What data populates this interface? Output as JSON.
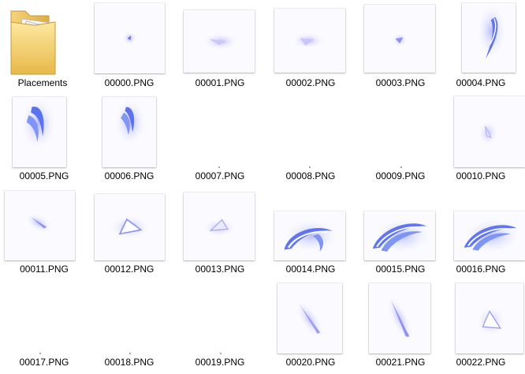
{
  "folder": {
    "label": "Placements",
    "icon": "folder-icon"
  },
  "files": [
    {
      "name": "00000.PNG",
      "preview": "small-spark"
    },
    {
      "name": "00001.PNG",
      "preview": "small-slash"
    },
    {
      "name": "00002.PNG",
      "preview": "small-slash"
    },
    {
      "name": "00003.PNG",
      "preview": "small-spark"
    },
    {
      "name": "00004.PNG",
      "preview": "curved-streak"
    },
    {
      "name": "00005.PNG",
      "preview": "curved-streak"
    },
    {
      "name": "00006.PNG",
      "preview": "curved-streak"
    },
    {
      "name": "00007.PNG",
      "preview": "blank"
    },
    {
      "name": "00008.PNG",
      "preview": "blank"
    },
    {
      "name": "00009.PNG",
      "preview": "blank"
    },
    {
      "name": "00010.PNG",
      "preview": "small-spark"
    },
    {
      "name": "00011.PNG",
      "preview": "diagonal-slash"
    },
    {
      "name": "00012.PNG",
      "preview": "triangle-slash"
    },
    {
      "name": "00013.PNG",
      "preview": "triangle-slash"
    },
    {
      "name": "00014.PNG",
      "preview": "arc-slash"
    },
    {
      "name": "00015.PNG",
      "preview": "arc-slash"
    },
    {
      "name": "00016.PNG",
      "preview": "arc-slash"
    },
    {
      "name": "00017.PNG",
      "preview": "blank"
    },
    {
      "name": "00018.PNG",
      "preview": "blank"
    },
    {
      "name": "00019.PNG",
      "preview": "blank"
    },
    {
      "name": "00020.PNG",
      "preview": "long-slash"
    },
    {
      "name": "00021.PNG",
      "preview": "long-slash"
    },
    {
      "name": "00022.PNG",
      "preview": "triangle-slash"
    }
  ]
}
